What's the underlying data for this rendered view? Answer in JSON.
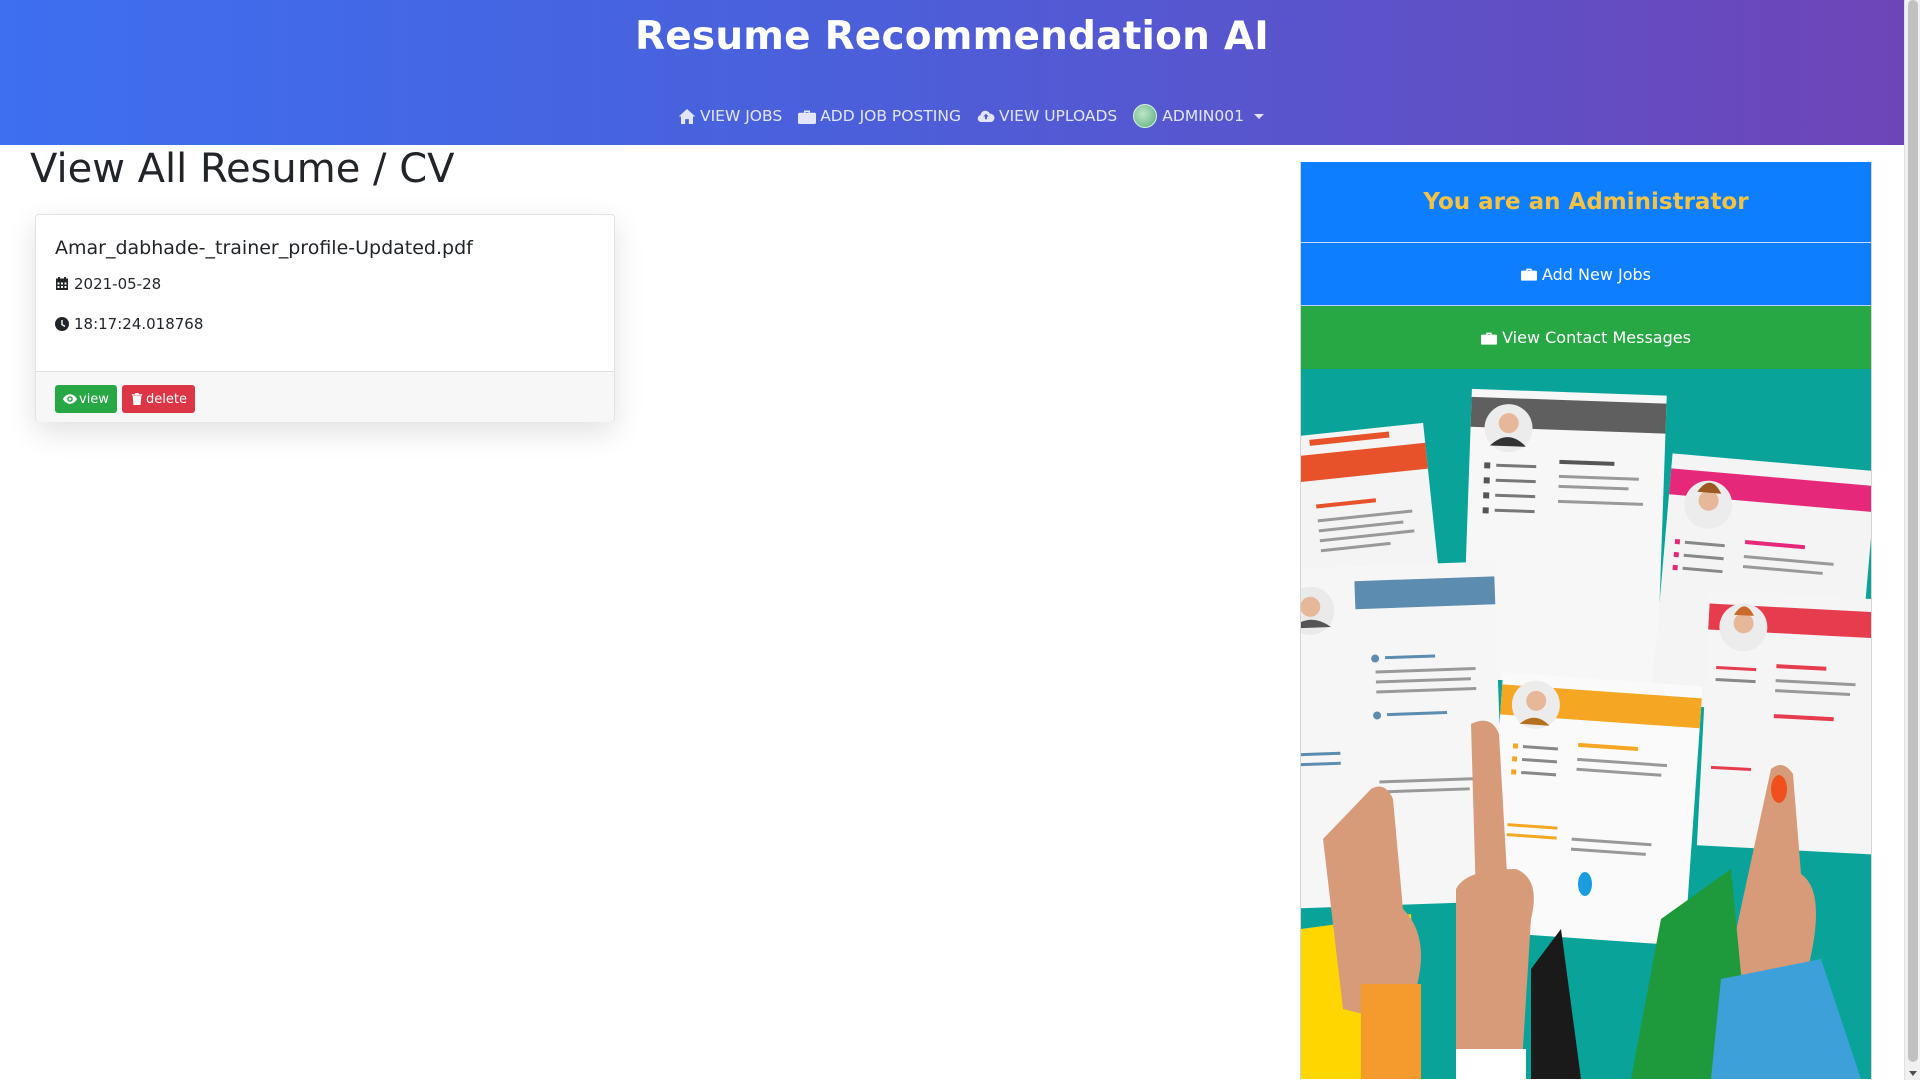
{
  "header": {
    "title": "Resume Recommendation AI",
    "nav": [
      {
        "label": "VIEW JOBS",
        "icon": "home-icon"
      },
      {
        "label": "ADD JOB POSTING",
        "icon": "briefcase-icon"
      },
      {
        "label": "VIEW UPLOADS",
        "icon": "cloud-upload-icon"
      },
      {
        "label": "ADMIN001",
        "icon": "avatar"
      }
    ]
  },
  "main": {
    "page_title": "View All Resume / CV",
    "resume": {
      "file_name": "Amar_dabhade-_trainer_profile-Updated.pdf",
      "date": "2021-05-28",
      "time": "18:17:24.018768",
      "view_label": "view",
      "delete_label": "delete"
    }
  },
  "sidebar": {
    "admin_text": "You are an Administrator",
    "add_jobs_label": "Add New Jobs",
    "contact_label": "View Contact Messages"
  },
  "colors": {
    "header_gradient_start": "#3d6ff0",
    "header_gradient_end": "#6e45b8",
    "primary_blue": "#0d7eff",
    "success_green": "#28a745",
    "danger_red": "#dc3545",
    "admin_text_gold": "#f5c242",
    "illustration_teal": "#0aa39a"
  }
}
